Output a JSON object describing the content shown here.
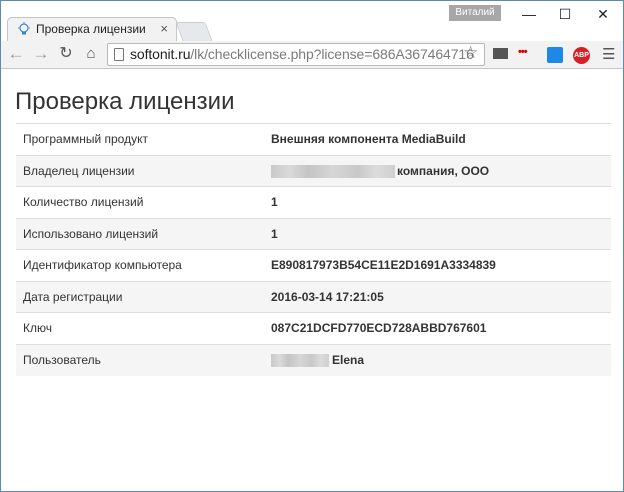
{
  "browser": {
    "tab_title": "Проверка лицензии",
    "tab_close": "×",
    "user_badge": "Виталий",
    "url_host": "softonit.ru",
    "url_rest": "/lk/checklicense.php?license=686A367464716"
  },
  "page": {
    "title": "Проверка лицензии",
    "rows": [
      {
        "label": "Программный продукт",
        "value": "Внешняя компонента MediaBuild"
      },
      {
        "label": "Владелец лицензии",
        "value": "компания, ООО",
        "redacted": true
      },
      {
        "label": "Количество лицензий",
        "value": "1"
      },
      {
        "label": "Использовано лицензий",
        "value": "1"
      },
      {
        "label": "Идентификатор компьютера",
        "value": "E890817973B54CE11E2D1691A3334839"
      },
      {
        "label": "Дата регистрации",
        "value": "2016-03-14 17:21:05"
      },
      {
        "label": "Ключ",
        "value": "087C21DCFD770ECD728ABBD767601"
      },
      {
        "label": "Пользователь",
        "value": "Elena",
        "redacted": true
      }
    ]
  },
  "colors": {
    "row_stripe": "#f5f5f5",
    "border": "#dddddd",
    "abp_red": "#d81f26"
  }
}
